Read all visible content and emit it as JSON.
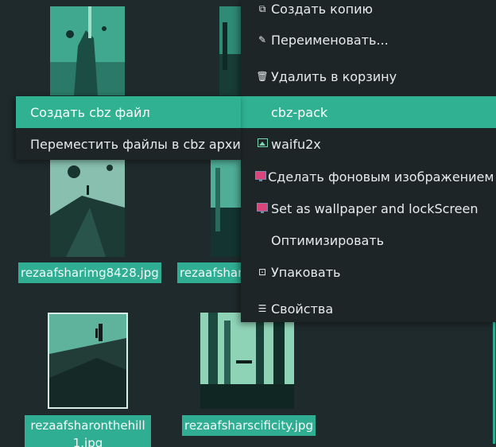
{
  "files": [
    {
      "name": "rezaafsharimg8428.jpg"
    },
    {
      "name": "rezaafsharі"
    },
    {
      "name": "rezaafsharonthehill1.jpg"
    },
    {
      "name": "rezaafsharscificity.jpg"
    }
  ],
  "context_menu": {
    "items": [
      {
        "label": "Создать копию",
        "icon": "copy-icon"
      },
      {
        "label": "Переименовать...",
        "icon": "pencil-icon"
      },
      {
        "label": "Удалить в корзину",
        "icon": "trash-icon"
      },
      {
        "label": "cbz-pack",
        "icon": null,
        "highlighted": true
      },
      {
        "label": "waifu2x",
        "icon": "image-icon"
      },
      {
        "label": "Сделать фоновым изображением ра",
        "icon": "monitor-icon"
      },
      {
        "label": "Set as wallpaper and lockScreen",
        "icon": "monitor-icon"
      },
      {
        "label": "Оптимизировать",
        "icon": null
      },
      {
        "label": "Упаковать",
        "icon": "archive-icon"
      },
      {
        "label": "Свойства",
        "icon": "properties-icon"
      }
    ]
  },
  "submenu": {
    "items": [
      {
        "label": "Создать cbz файл",
        "highlighted": true
      },
      {
        "label": "Переместить файлы в cbz архив"
      }
    ]
  },
  "colors": {
    "background": "#1f2a2c",
    "accent": "#2fb192",
    "menu_bg": "#1e2527"
  }
}
